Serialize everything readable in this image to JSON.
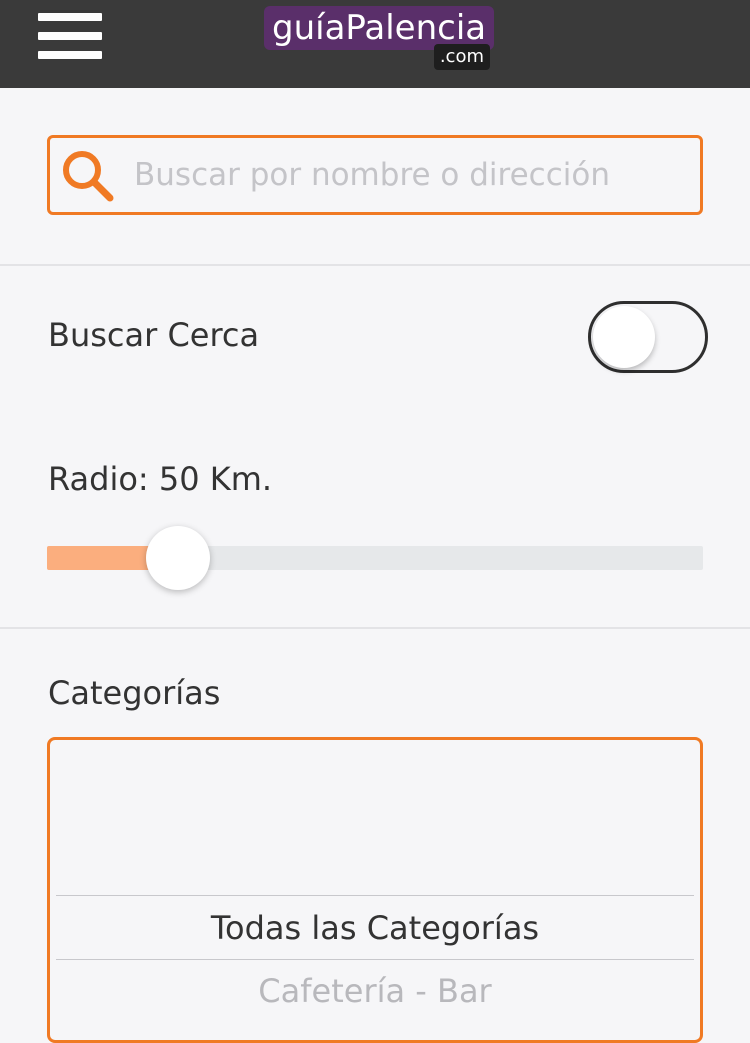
{
  "header": {
    "logo_main": "guíaPalencia",
    "logo_suffix": ".com",
    "menu_icon": "hamburger-menu-icon",
    "background_color": "#3a3a3a",
    "logo_color": "#5a2f6a"
  },
  "search": {
    "placeholder": "Buscar por nombre o dirección",
    "value": "",
    "icon": "search-icon",
    "accent_color": "#f07a24"
  },
  "nearby": {
    "label": "Buscar Cerca",
    "enabled": false
  },
  "radius": {
    "label": "Radio: 50 Km.",
    "level_fraction": 0.2
  },
  "categories": {
    "label": "Categorías",
    "options": [
      {
        "label": "Todas las Categorías",
        "selected": true
      },
      {
        "label": "Cafetería - Bar",
        "selected": false
      }
    ]
  }
}
